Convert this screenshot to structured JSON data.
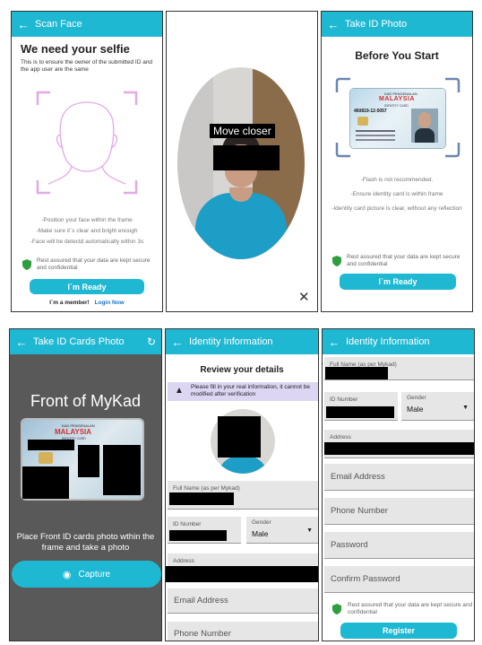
{
  "p1": {
    "title": "Scan Face",
    "heading": "We need your selfie",
    "subtitle": "This is to ensure the owner of the submitted ID and the app user are the same",
    "hints": [
      "-Position your face within the frame",
      "-Make sure it`s clear and bright enough",
      "-Face will be detectd automatically within 3s"
    ],
    "secure": "Rest assured that your data are kept secure and confidential",
    "button": "I`m Ready",
    "member": "I`m a member!",
    "login": "Login Now"
  },
  "p2": {
    "status": "Move closer"
  },
  "p3": {
    "title": "Take ID Photo",
    "heading": "Before You Start",
    "card_line1": "KAD PENGENALAN",
    "card_line2": "MALAYSIA",
    "card_line3": "IDENTITY CARD",
    "card_number": "460819-12-5057",
    "hints": [
      "-Flash is not recommended.",
      "-Ensure identity card is within frame",
      "-Identity card picture is clear, without any reflection"
    ],
    "secure": "Rest assured that your data are kept secure and confidential",
    "button": "I`m Ready"
  },
  "p4": {
    "title": "Take ID Cards Photo",
    "heading": "Front of MyKad",
    "card_line1": "KAD PENGENALAN",
    "card_line2": "MALAYSIA",
    "card_line3": "IDENTITY CARD",
    "instruction": "Place Front ID cards photo wthin the frame and take a photo",
    "button": "Capture"
  },
  "p5": {
    "title": "Identity Information",
    "heading": "Review your details",
    "warning": "Please fill in your real information, it cannot be modified after verification",
    "full_name_label": "Full Name (as per Mykad)",
    "id_label": "ID Number",
    "gender_label": "Gender",
    "gender_value": "Male",
    "address_label": "Address",
    "email_placeholder": "Email Address",
    "phone_placeholder": "Phone Number"
  },
  "p6": {
    "title": "Identity Information",
    "full_name_label": "Full Name (as per Mykad)",
    "id_label": "ID Number",
    "gender_label": "Gender",
    "gender_value": "Male",
    "address_label": "Address",
    "email_placeholder": "Email Address",
    "phone_placeholder": "Phone Number",
    "password_placeholder": "Password",
    "confirm_placeholder": "Confirm Password",
    "secure": "Rest assured that your data are kept secure and confidential",
    "button": "Register"
  },
  "colors": {
    "accent": "#1fb8d3",
    "shield": "#2e9e3f",
    "face_outline": "#e3a8e6"
  }
}
